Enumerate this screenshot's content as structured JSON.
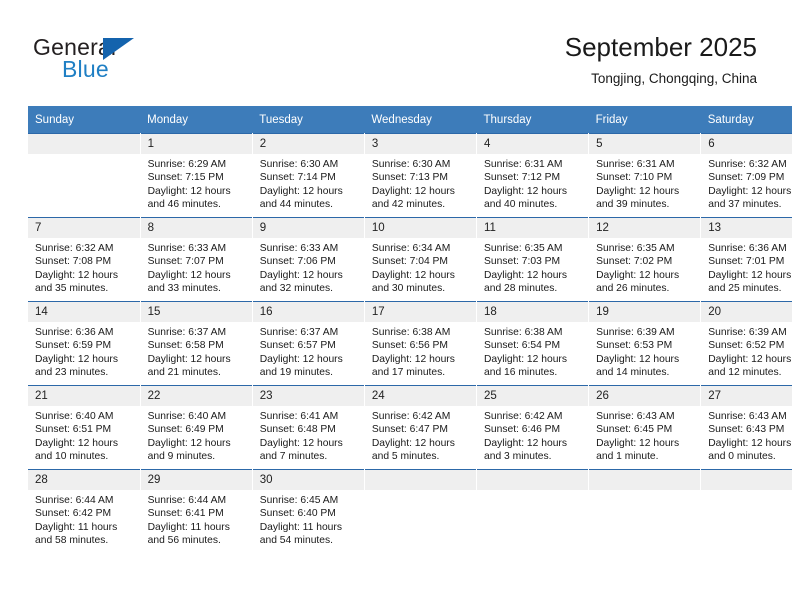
{
  "logo": {
    "word1": "General",
    "word2": "Blue",
    "triangle_color": "#1463ad",
    "blue_color": "#1f7fc4"
  },
  "header": {
    "title": "September 2025",
    "location": "Tongjing, Chongqing, China"
  },
  "theme": {
    "header_blue": "#3d7cba",
    "row_rule_blue": "#2c68a8",
    "daynum_band": "#efefef"
  },
  "weekday_headers": [
    "Sunday",
    "Monday",
    "Tuesday",
    "Wednesday",
    "Thursday",
    "Friday",
    "Saturday"
  ],
  "calendar": {
    "weeks": [
      [
        {
          "day": "",
          "lines": []
        },
        {
          "day": "1",
          "lines": [
            "Sunrise: 6:29 AM",
            "Sunset: 7:15 PM",
            "Daylight: 12 hours",
            "and 46 minutes."
          ]
        },
        {
          "day": "2",
          "lines": [
            "Sunrise: 6:30 AM",
            "Sunset: 7:14 PM",
            "Daylight: 12 hours",
            "and 44 minutes."
          ]
        },
        {
          "day": "3",
          "lines": [
            "Sunrise: 6:30 AM",
            "Sunset: 7:13 PM",
            "Daylight: 12 hours",
            "and 42 minutes."
          ]
        },
        {
          "day": "4",
          "lines": [
            "Sunrise: 6:31 AM",
            "Sunset: 7:12 PM",
            "Daylight: 12 hours",
            "and 40 minutes."
          ]
        },
        {
          "day": "5",
          "lines": [
            "Sunrise: 6:31 AM",
            "Sunset: 7:10 PM",
            "Daylight: 12 hours",
            "and 39 minutes."
          ]
        },
        {
          "day": "6",
          "lines": [
            "Sunrise: 6:32 AM",
            "Sunset: 7:09 PM",
            "Daylight: 12 hours",
            "and 37 minutes."
          ]
        }
      ],
      [
        {
          "day": "7",
          "lines": [
            "Sunrise: 6:32 AM",
            "Sunset: 7:08 PM",
            "Daylight: 12 hours",
            "and 35 minutes."
          ]
        },
        {
          "day": "8",
          "lines": [
            "Sunrise: 6:33 AM",
            "Sunset: 7:07 PM",
            "Daylight: 12 hours",
            "and 33 minutes."
          ]
        },
        {
          "day": "9",
          "lines": [
            "Sunrise: 6:33 AM",
            "Sunset: 7:06 PM",
            "Daylight: 12 hours",
            "and 32 minutes."
          ]
        },
        {
          "day": "10",
          "lines": [
            "Sunrise: 6:34 AM",
            "Sunset: 7:04 PM",
            "Daylight: 12 hours",
            "and 30 minutes."
          ]
        },
        {
          "day": "11",
          "lines": [
            "Sunrise: 6:35 AM",
            "Sunset: 7:03 PM",
            "Daylight: 12 hours",
            "and 28 minutes."
          ]
        },
        {
          "day": "12",
          "lines": [
            "Sunrise: 6:35 AM",
            "Sunset: 7:02 PM",
            "Daylight: 12 hours",
            "and 26 minutes."
          ]
        },
        {
          "day": "13",
          "lines": [
            "Sunrise: 6:36 AM",
            "Sunset: 7:01 PM",
            "Daylight: 12 hours",
            "and 25 minutes."
          ]
        }
      ],
      [
        {
          "day": "14",
          "lines": [
            "Sunrise: 6:36 AM",
            "Sunset: 6:59 PM",
            "Daylight: 12 hours",
            "and 23 minutes."
          ]
        },
        {
          "day": "15",
          "lines": [
            "Sunrise: 6:37 AM",
            "Sunset: 6:58 PM",
            "Daylight: 12 hours",
            "and 21 minutes."
          ]
        },
        {
          "day": "16",
          "lines": [
            "Sunrise: 6:37 AM",
            "Sunset: 6:57 PM",
            "Daylight: 12 hours",
            "and 19 minutes."
          ]
        },
        {
          "day": "17",
          "lines": [
            "Sunrise: 6:38 AM",
            "Sunset: 6:56 PM",
            "Daylight: 12 hours",
            "and 17 minutes."
          ]
        },
        {
          "day": "18",
          "lines": [
            "Sunrise: 6:38 AM",
            "Sunset: 6:54 PM",
            "Daylight: 12 hours",
            "and 16 minutes."
          ]
        },
        {
          "day": "19",
          "lines": [
            "Sunrise: 6:39 AM",
            "Sunset: 6:53 PM",
            "Daylight: 12 hours",
            "and 14 minutes."
          ]
        },
        {
          "day": "20",
          "lines": [
            "Sunrise: 6:39 AM",
            "Sunset: 6:52 PM",
            "Daylight: 12 hours",
            "and 12 minutes."
          ]
        }
      ],
      [
        {
          "day": "21",
          "lines": [
            "Sunrise: 6:40 AM",
            "Sunset: 6:51 PM",
            "Daylight: 12 hours",
            "and 10 minutes."
          ]
        },
        {
          "day": "22",
          "lines": [
            "Sunrise: 6:40 AM",
            "Sunset: 6:49 PM",
            "Daylight: 12 hours",
            "and 9 minutes."
          ]
        },
        {
          "day": "23",
          "lines": [
            "Sunrise: 6:41 AM",
            "Sunset: 6:48 PM",
            "Daylight: 12 hours",
            "and 7 minutes."
          ]
        },
        {
          "day": "24",
          "lines": [
            "Sunrise: 6:42 AM",
            "Sunset: 6:47 PM",
            "Daylight: 12 hours",
            "and 5 minutes."
          ]
        },
        {
          "day": "25",
          "lines": [
            "Sunrise: 6:42 AM",
            "Sunset: 6:46 PM",
            "Daylight: 12 hours",
            "and 3 minutes."
          ]
        },
        {
          "day": "26",
          "lines": [
            "Sunrise: 6:43 AM",
            "Sunset: 6:45 PM",
            "Daylight: 12 hours",
            "and 1 minute."
          ]
        },
        {
          "day": "27",
          "lines": [
            "Sunrise: 6:43 AM",
            "Sunset: 6:43 PM",
            "Daylight: 12 hours",
            "and 0 minutes."
          ]
        }
      ],
      [
        {
          "day": "28",
          "lines": [
            "Sunrise: 6:44 AM",
            "Sunset: 6:42 PM",
            "Daylight: 11 hours",
            "and 58 minutes."
          ]
        },
        {
          "day": "29",
          "lines": [
            "Sunrise: 6:44 AM",
            "Sunset: 6:41 PM",
            "Daylight: 11 hours",
            "and 56 minutes."
          ]
        },
        {
          "day": "30",
          "lines": [
            "Sunrise: 6:45 AM",
            "Sunset: 6:40 PM",
            "Daylight: 11 hours",
            "and 54 minutes."
          ]
        },
        {
          "day": "",
          "lines": []
        },
        {
          "day": "",
          "lines": []
        },
        {
          "day": "",
          "lines": []
        },
        {
          "day": "",
          "lines": []
        }
      ]
    ]
  }
}
